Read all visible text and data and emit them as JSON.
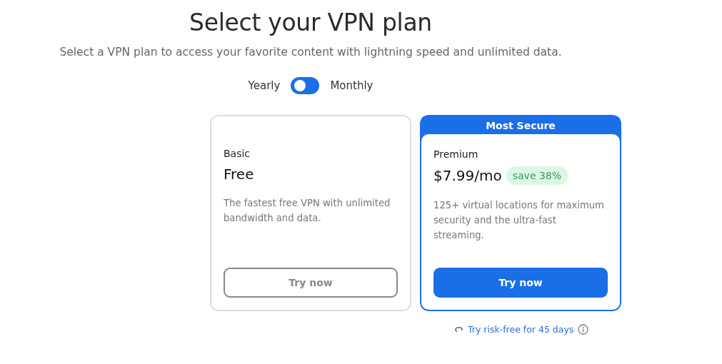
{
  "heading": "Select your VPN plan",
  "subtitle": "Select a VPN plan to access your favorite content with lightning speed and unlimited data.",
  "billing_toggle": {
    "on": false,
    "labels": [
      "Yearly",
      "Monthly"
    ]
  },
  "plans": [
    {
      "kind": "basic",
      "name": "Basic",
      "price": "Free",
      "description": "The fastest free VPN with unlimited bandwidth and data.",
      "button": "Try now"
    },
    {
      "kind": "featured",
      "badge": "Most Secure",
      "name": "Premium",
      "price": "$7.99/mo",
      "discount": "save 38%",
      "description": "125+ virtual locations for maximum security and the ultra-fast streaming.",
      "button": "Try now"
    }
  ],
  "trial_link": "Try risk-free for 45 days"
}
